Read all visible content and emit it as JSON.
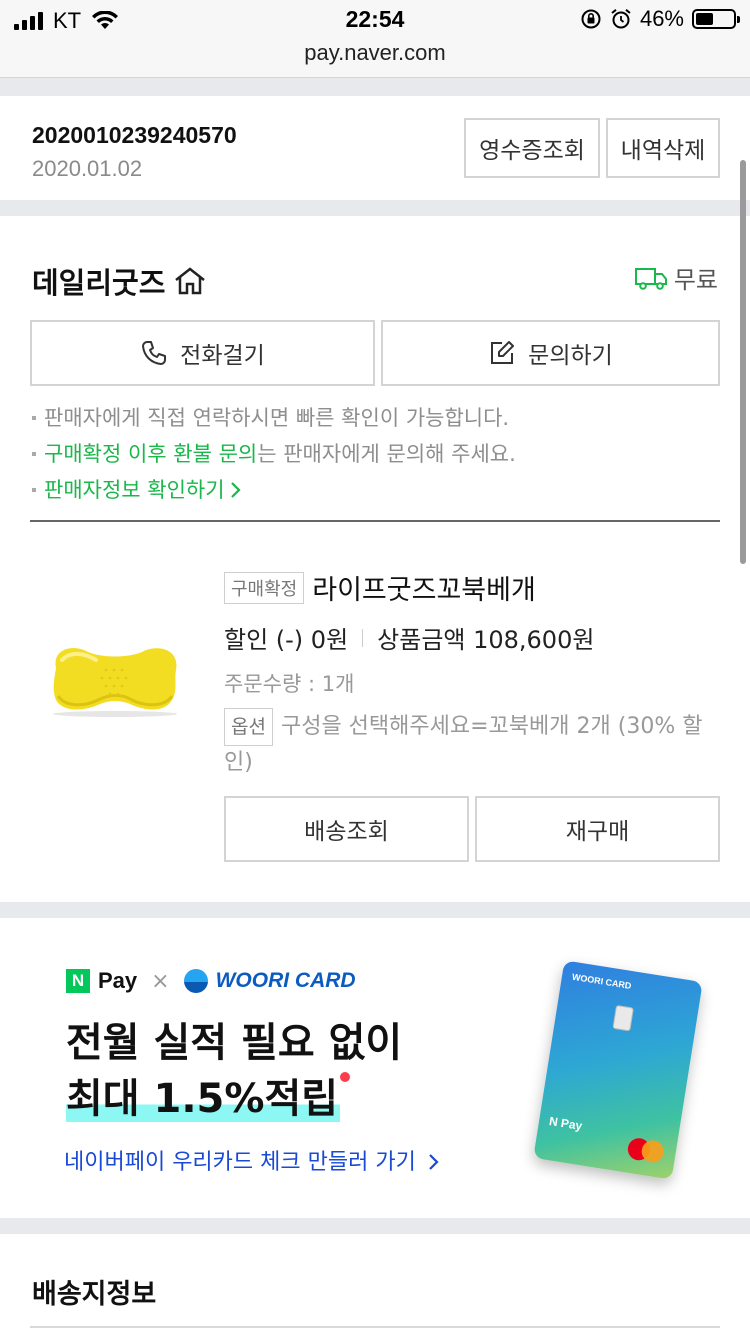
{
  "status_bar": {
    "carrier": "KT",
    "time": "22:54",
    "battery": "46%",
    "battery_level": 0.46,
    "url": "pay.naver.com"
  },
  "order": {
    "number": "2020010239240570",
    "date": "2020.01.02",
    "receipt_button": "영수증조회",
    "delete_button": "내역삭제"
  },
  "seller": {
    "name": "데일리굿즈",
    "shipping": "무료",
    "call_button": "전화걸기",
    "inquiry_button": "문의하기",
    "notes": [
      "판매자에게 직접 연락하시면 빠른 확인이 가능합니다.",
      "는 판매자에게 문의해 주세요."
    ],
    "refund_highlight": "구매확정 이후 환불 문의",
    "seller_info_link": "판매자정보 확인하기"
  },
  "product": {
    "status_badge": "구매확정",
    "name": "라이프굿즈꼬북베개",
    "discount": "할인 (-) 0원",
    "amount": "상품금액 108,600원",
    "quantity": "주문수량 : 1개",
    "option_badge": "옵션",
    "option_text": "구성을 선택해주세요=꼬북베개 2개 (30% 할인)",
    "track_button": "배송조회",
    "reorder_button": "재구매"
  },
  "ad": {
    "npay": "Pay",
    "npay_n": "N",
    "times": "×",
    "woori": "WOORI CARD",
    "line1": "전월 실적 필요 없이",
    "line2_prefix": "최대 ",
    "line2_highlight": "1.5%적립",
    "link": "네이버페이 우리카드 체크 만들러 가기",
    "card_label": "WOORI CARD",
    "card_npay": "N Pay"
  },
  "delivery": {
    "title": "배송지정보"
  },
  "colors": {
    "green": "#1ab74b",
    "link_blue": "#1a49d4",
    "highlight": "#8cf7f3"
  }
}
